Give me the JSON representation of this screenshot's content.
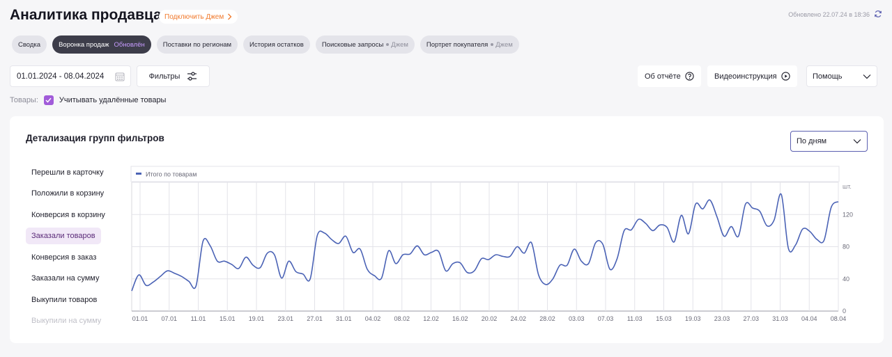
{
  "header": {
    "title": "Аналитика продавца",
    "connect_label": "Подключить Джем",
    "updated": "Обновлено 22.07.24 в 18:36"
  },
  "tabs": [
    {
      "label": "Сводка"
    },
    {
      "label": "Воронка продаж",
      "badge": "Обновлён",
      "active": true
    },
    {
      "label": "Поставки по регионам"
    },
    {
      "label": "История остатков"
    },
    {
      "label": "Поисковые запросы",
      "tag": "Джем"
    },
    {
      "label": "Портрет покупателя",
      "tag": "Джем"
    }
  ],
  "toolbar": {
    "date_range": "01.01.2024 - 08.04.2024",
    "filters_label": "Фильтры",
    "about_report": "Об отчёте",
    "video_guide": "Видеоинструкция",
    "help": "Помощь"
  },
  "goods": {
    "label": "Товары:",
    "include_deleted": "Учитывать удалённые товары",
    "checked": true
  },
  "card": {
    "title": "Детализация групп фильтров",
    "period": "По дням",
    "metrics": [
      {
        "label": "Перешли в карточку"
      },
      {
        "label": "Положили в корзину"
      },
      {
        "label": "Конверсия в корзину"
      },
      {
        "label": "Заказали товаров",
        "active": true
      },
      {
        "label": "Конверсия в заказ"
      },
      {
        "label": "Заказали на сумму"
      },
      {
        "label": "Выкупили товаров"
      },
      {
        "label": "Выкупили на сумму",
        "faded": true
      }
    ]
  },
  "chart_data": {
    "type": "line",
    "legend": [
      "Итого по товарам"
    ],
    "ylabel": "шт.",
    "ylim": [
      0,
      160
    ],
    "yticks": [
      0,
      40,
      80,
      120
    ],
    "xticks": [
      "01.01",
      "07.01",
      "11.01",
      "15.01",
      "19.01",
      "23.01",
      "27.01",
      "31.01",
      "04.02",
      "08.02",
      "12.02",
      "16.02",
      "20.02",
      "24.02",
      "28.02",
      "03.03",
      "07.03",
      "11.03",
      "15.03",
      "19.03",
      "23.03",
      "27.03",
      "31.03",
      "04.04",
      "08.04"
    ],
    "series": [
      {
        "name": "Итого по товарам",
        "color": "#4a62b5",
        "values": [
          25,
          45,
          32,
          36,
          43,
          50,
          47,
          43,
          37,
          31,
          87,
          81,
          62,
          62,
          58,
          53,
          67,
          57,
          54,
          72,
          70,
          41,
          62,
          49,
          46,
          40,
          94,
          97,
          89,
          84,
          93,
          73,
          77,
          52,
          44,
          41,
          75,
          59,
          70,
          71,
          81,
          70,
          73,
          74,
          50,
          59,
          60,
          48,
          50,
          65,
          64,
          70,
          68,
          68,
          80,
          72,
          85,
          45,
          33,
          40,
          57,
          57,
          77,
          62,
          59,
          85,
          83,
          52,
          65,
          100,
          101,
          114,
          109,
          100,
          107,
          104,
          86,
          119,
          96,
          133,
          127,
          138,
          117,
          93,
          105,
          93,
          133,
          128,
          124,
          106,
          113,
          145,
          78,
          82,
          102,
          99,
          89,
          88,
          129,
          136
        ]
      }
    ]
  }
}
